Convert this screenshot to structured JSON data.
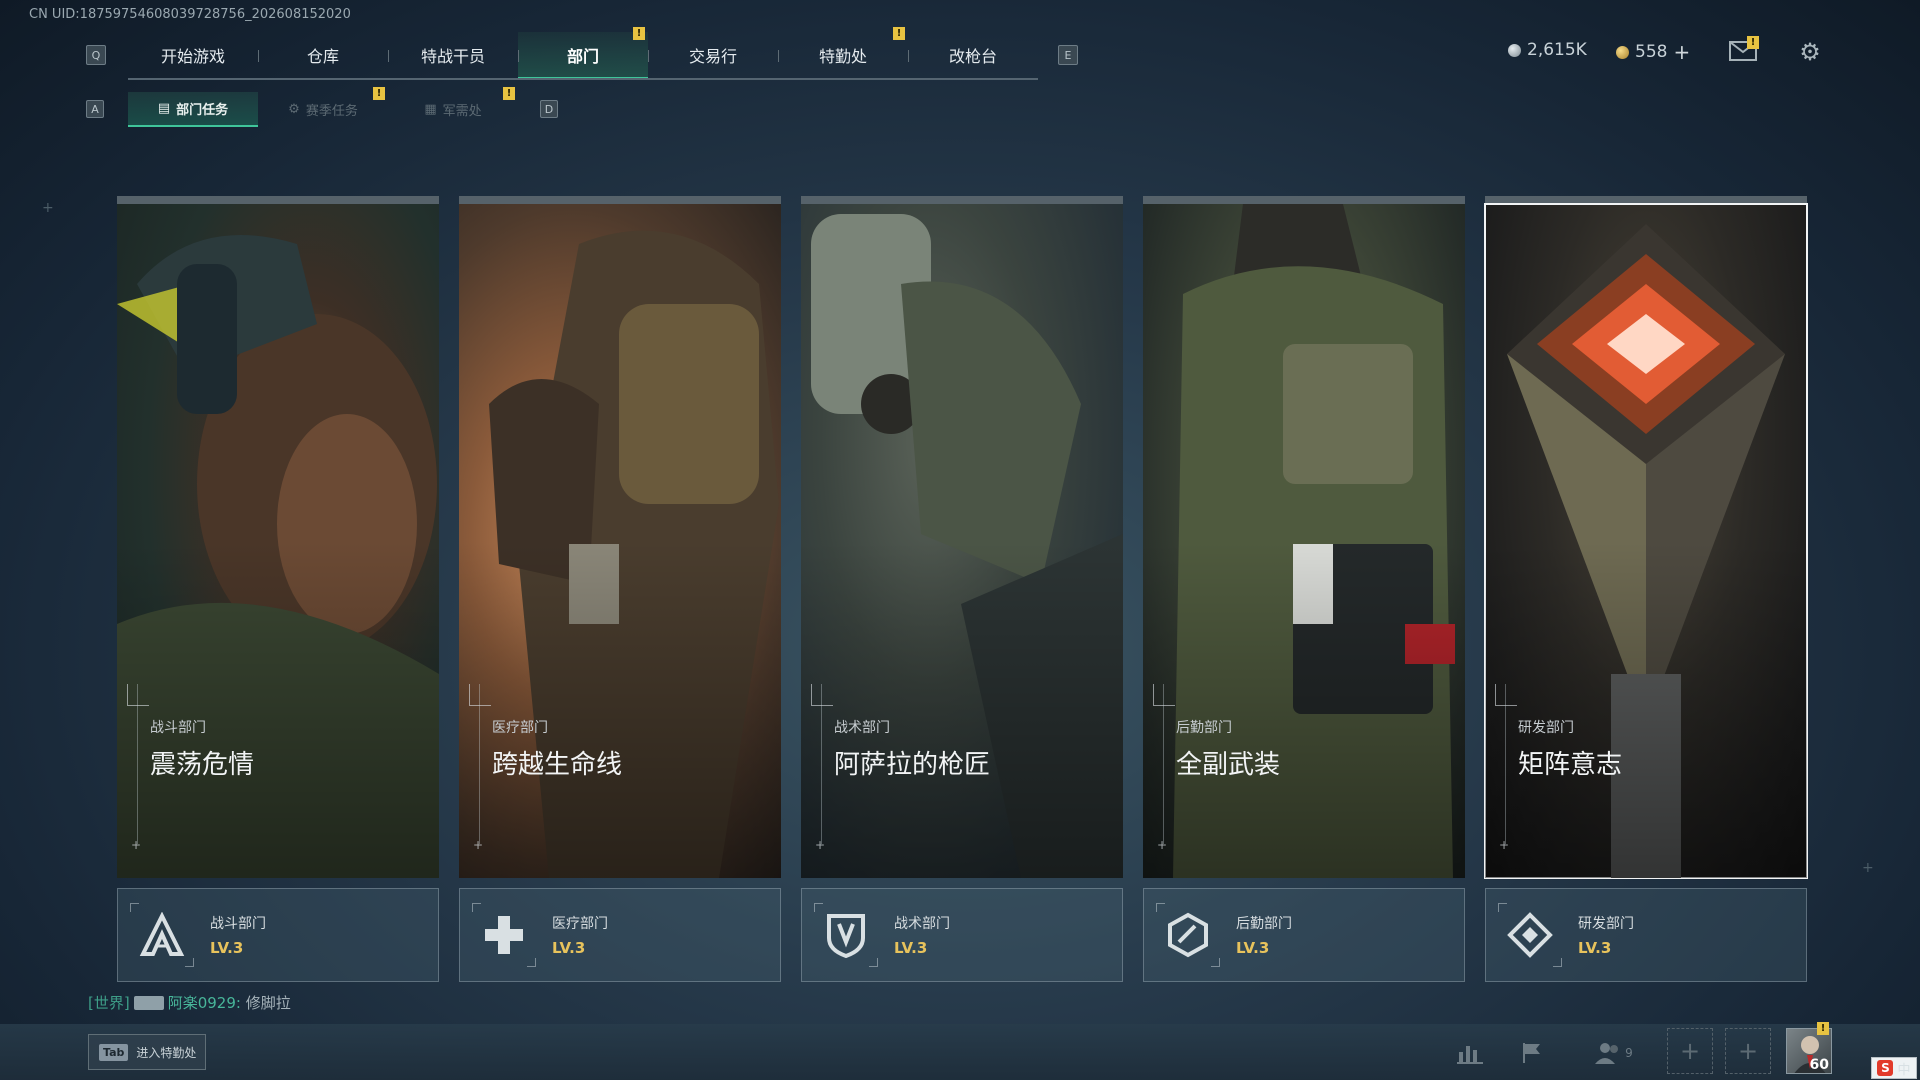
{
  "uid": "CN UID:18759754608039728756_202608152020",
  "keys": {
    "left": "Q",
    "right": "E",
    "sub_left": "A",
    "sub_right": "D"
  },
  "nav": {
    "tabs": [
      {
        "label": "开始游戏"
      },
      {
        "label": "仓库"
      },
      {
        "label": "特战干员"
      },
      {
        "label": "部门"
      },
      {
        "label": "交易行"
      },
      {
        "label": "特勤处"
      },
      {
        "label": "改枪台"
      }
    ],
    "active": "部门",
    "alert_mark": "!"
  },
  "subtabs": [
    {
      "label": "部门任务"
    },
    {
      "label": "赛季任务"
    },
    {
      "label": "军需处"
    }
  ],
  "currency": {
    "silver": "2,615K",
    "gold": "558",
    "add": "+"
  },
  "departments": [
    {
      "category": "战斗部门",
      "title": "震荡危情",
      "level": "LV.3",
      "icon": "assault-a-icon"
    },
    {
      "category": "医疗部门",
      "title": "跨越生命线",
      "level": "LV.3",
      "icon": "medical-cross-icon"
    },
    {
      "category": "战术部门",
      "title": "阿萨拉的枪匠",
      "level": "LV.3",
      "icon": "tactical-shield-icon"
    },
    {
      "category": "后勤部门",
      "title": "全副武装",
      "level": "LV.3",
      "icon": "logistics-hex-icon"
    },
    {
      "category": "研发部门",
      "title": "矩阵意志",
      "level": "LV.3",
      "icon": "research-diamond-icon"
    }
  ],
  "selected_department": "研发部门",
  "chat": {
    "channel": "[世界]",
    "name": "阿楽0929:",
    "message": "修脚拉"
  },
  "bottom": {
    "tab_key": "Tab",
    "tab_label": "进入特勤处",
    "friends_count": "9",
    "player_level": "60"
  },
  "ime": {
    "logo": "S",
    "label": "中"
  },
  "colors": {
    "accent": "#3fc59a",
    "level_gold": "#e8c35c",
    "alert": "#e8c341"
  }
}
